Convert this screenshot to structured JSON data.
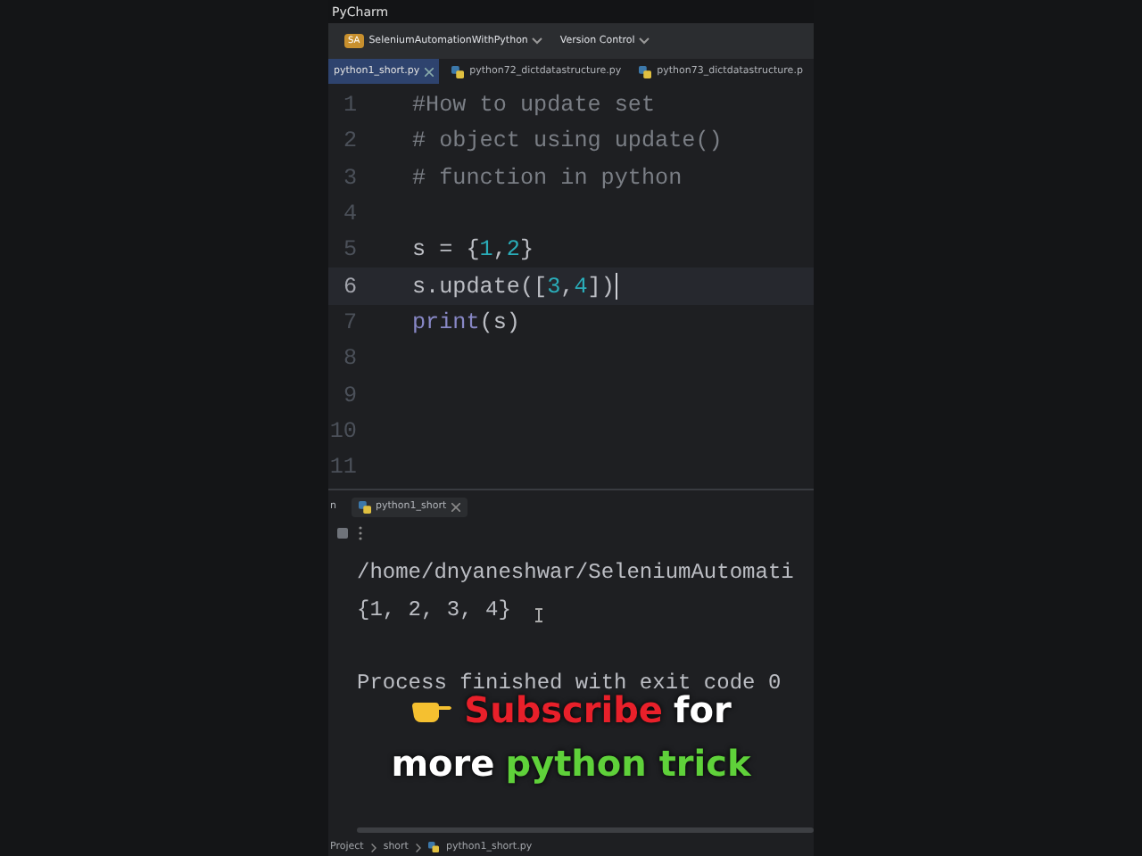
{
  "app_title": "PyCharm",
  "toolbar": {
    "project_badge": "SA",
    "project": "SeleniumAutomationWithPython",
    "vcs": "Version Control"
  },
  "tabs": [
    {
      "label": "python1_short.py",
      "selected": true
    },
    {
      "label": "python72_dictdatastructure.py",
      "selected": false
    },
    {
      "label": "python73_dictdatastructure.p",
      "selected": false
    }
  ],
  "editor": {
    "lines": [
      {
        "number": "1",
        "current": false,
        "tokens": [
          {
            "text": "#How to update set",
            "kind": "comment"
          }
        ]
      },
      {
        "number": "2",
        "current": false,
        "tokens": [
          {
            "text": "# object using update()",
            "kind": "comment"
          }
        ]
      },
      {
        "number": "3",
        "current": false,
        "tokens": [
          {
            "text": "# function in python",
            "kind": "comment"
          }
        ]
      },
      {
        "number": "4",
        "current": false
      },
      {
        "number": "5",
        "current": false,
        "tokens": [
          {
            "text": "s = ",
            "kind": "plain"
          },
          {
            "text": "{",
            "kind": "plain"
          },
          {
            "text": "1",
            "kind": "number"
          },
          {
            "text": ",",
            "kind": "plain"
          },
          {
            "text": "2",
            "kind": "number"
          },
          {
            "text": "}",
            "kind": "plain"
          }
        ]
      },
      {
        "number": "6",
        "current": true,
        "tokens": [
          {
            "text": "s.update(",
            "kind": "plain"
          },
          {
            "text": "[",
            "kind": "plain"
          },
          {
            "text": "3",
            "kind": "number"
          },
          {
            "text": ",",
            "kind": "plain"
          },
          {
            "text": "4",
            "kind": "number"
          },
          {
            "text": "])",
            "kind": "plain"
          }
        ]
      },
      {
        "number": "7",
        "current": false,
        "tokens": [
          {
            "text": "print",
            "kind": "builtin"
          },
          {
            "text": "(s)",
            "kind": "plain"
          }
        ]
      },
      {
        "number": "8",
        "current": false
      },
      {
        "number": "9",
        "current": false
      },
      {
        "number": "10",
        "current": false
      },
      {
        "number": "11",
        "current": false
      }
    ]
  },
  "run_panel": {
    "tab_stub": "n",
    "tab": "python1_short",
    "output": [
      "/home/dnyaneshwar/SeleniumAutomati",
      "{1, 2, 3, 4}",
      "Process finished with exit code 0"
    ]
  },
  "caption": {
    "lines": [
      [
        {
          "text": "Subscribe",
          "color": "#e8202a"
        },
        {
          "text": "for",
          "color": "#ffffff"
        }
      ],
      [
        {
          "text": "more",
          "color": "#ffffff"
        },
        {
          "text": "python trick",
          "color": "#5fd13a"
        }
      ]
    ]
  },
  "breadcrumbs": [
    "Project",
    "short",
    "python1_short.py"
  ]
}
